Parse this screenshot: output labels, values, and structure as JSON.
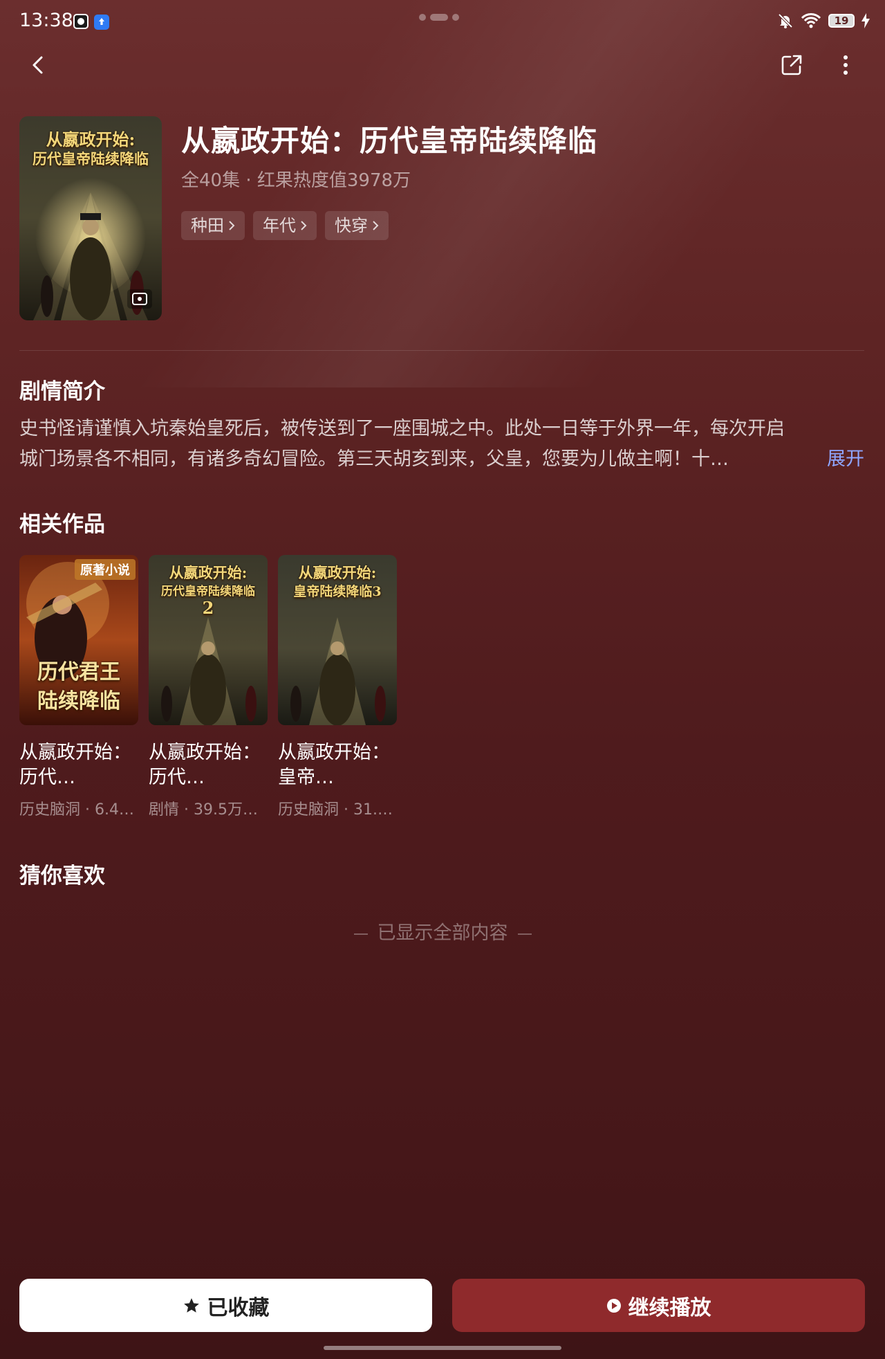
{
  "status_bar": {
    "time": "13:38",
    "battery": "19"
  },
  "show": {
    "title": "从嬴政开始：历代皇帝陆续降临",
    "meta": "全40集 · 红果热度值3978万",
    "cover_line1": "从嬴政开始:",
    "cover_line2": "历代皇帝陆续降临",
    "tags": [
      {
        "label": "种田"
      },
      {
        "label": "年代"
      },
      {
        "label": "快穿"
      }
    ]
  },
  "synopsis": {
    "heading": "剧情简介",
    "line1": "史书怪请谨慎入坑秦始皇死后，被传送到了一座围城之中。此处一日等于外界一年，每次开启",
    "line2": "城门场景各不相同，有诸多奇幻冒险。第三天胡亥到来，父皇，您要为儿做主啊！十…",
    "expand_label": "展开"
  },
  "related": {
    "heading": "相关作品",
    "items": [
      {
        "name": "从嬴政开始：历代…",
        "meta": "历史脑洞 · 6.4…",
        "badge": "原著小说",
        "cover_line1": "历代君王",
        "cover_line2": "陆续降临"
      },
      {
        "name": "从嬴政开始：历代…",
        "meta": "剧情 · 39.5万…",
        "cover_line1": "从嬴政开始:",
        "cover_line2": "历代皇帝陆续降临",
        "cover_line3": "2"
      },
      {
        "name": "从嬴政开始：皇帝…",
        "meta": "历史脑洞 · 31.…",
        "cover_line1": "从嬴政开始:",
        "cover_line2": "皇帝陆续降临3"
      }
    ]
  },
  "recommend": {
    "heading": "猜你喜欢",
    "end_text": "已显示全部内容"
  },
  "actions": {
    "favorite_label": "已收藏",
    "play_label": "继续播放"
  },
  "colors": {
    "background": "#5a2224",
    "play_button": "#8f2a2c",
    "link": "#8fa6ff",
    "cover_title": "#f3d77a"
  }
}
